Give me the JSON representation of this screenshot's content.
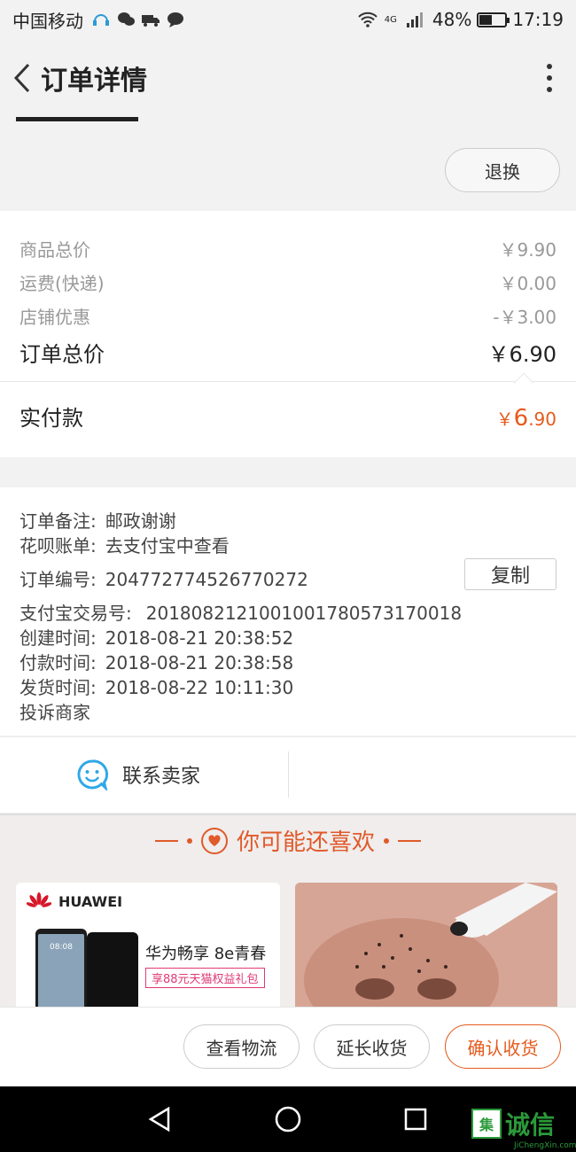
{
  "status_bar": {
    "carrier": "中国移动",
    "network": "4G",
    "battery": "48%",
    "battery_level": 0.48,
    "time": "17:19"
  },
  "header": {
    "title": "订单详情"
  },
  "actions": {
    "refund_label": "退换"
  },
  "price_summary": {
    "rows": [
      {
        "label": "商品总价",
        "value": "￥9.90"
      },
      {
        "label": "运费(快递)",
        "value": "￥0.00"
      },
      {
        "label": "店铺优惠",
        "value": "-￥3.00"
      }
    ],
    "total_label": "订单总价",
    "total_value": "￥6.90",
    "paid_label": "实付款",
    "paid_currency": "￥",
    "paid_int": "6",
    "paid_dec": ".90"
  },
  "order_info": {
    "note": {
      "label": "订单备注:",
      "value": "邮政谢谢"
    },
    "huabei": {
      "label": "花呗账单:",
      "value": "去支付宝中查看"
    },
    "order_no": {
      "label": "订单编号:",
      "value": "2047727745267702​72"
    },
    "copy_label": "复制",
    "alipay_no": {
      "label": "支付宝交易号:",
      "value": "2018082121001001780573170018"
    },
    "created": {
      "label": "创建时间:",
      "value": "2018-08-21 20:38:52"
    },
    "paid": {
      "label": "付款时间:",
      "value": "2018-08-21 20:38:58"
    },
    "shipped": {
      "label": "发货时间:",
      "value": "2018-08-22 10:11:30"
    },
    "complain_label": "投诉商家"
  },
  "contact": {
    "label": "联系卖家",
    "icon": "chat-smile-icon"
  },
  "recommend": {
    "title": "你可能还喜欢",
    "products": [
      {
        "brand": "HUAWEI",
        "name": "华为畅享 8e青春",
        "tag": "享88元天猫权益礼包",
        "screen_time": "08:08"
      },
      {
        "image": "nose-strip-photo"
      }
    ]
  },
  "bottom_bar": {
    "logistics_label": "查看物流",
    "extend_label": "延长收货",
    "confirm_label": "确认收货"
  },
  "watermark": {
    "box_char": "集",
    "text": "诚信",
    "sub": "JiChengXin.com"
  },
  "colors": {
    "accent": "#e55a1d",
    "reco": "#e05a2a",
    "watermark": "#2b9a3a"
  }
}
